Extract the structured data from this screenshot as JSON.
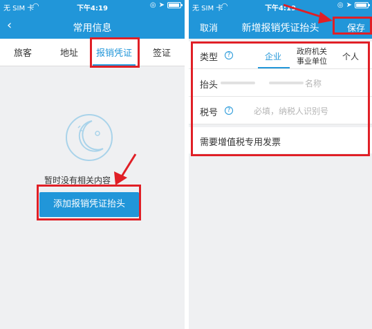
{
  "status": {
    "carrier": "无 SIM 卡",
    "time": "下午4:19"
  },
  "left": {
    "title": "常用信息",
    "tabs": [
      "旅客",
      "地址",
      "报销凭证",
      "签证"
    ],
    "empty_text": "暂时没有相关内容",
    "add_button": "添加报销凭证抬头"
  },
  "right": {
    "cancel": "取消",
    "title": "新增报销凭证抬头",
    "save": "保存",
    "type_label": "类型",
    "type_options": {
      "enterprise": "企业",
      "gov_line1": "政府机关",
      "gov_line2": "事业单位",
      "personal": "个人"
    },
    "header_label": "抬头",
    "header_placeholder_tail": "名称",
    "tax_label": "税号",
    "tax_placeholder": "必填，纳税人识别号",
    "vat_label": "需要增值税专用发票"
  },
  "colors": {
    "brand": "#2196d9",
    "annotation": "#e01f26"
  }
}
